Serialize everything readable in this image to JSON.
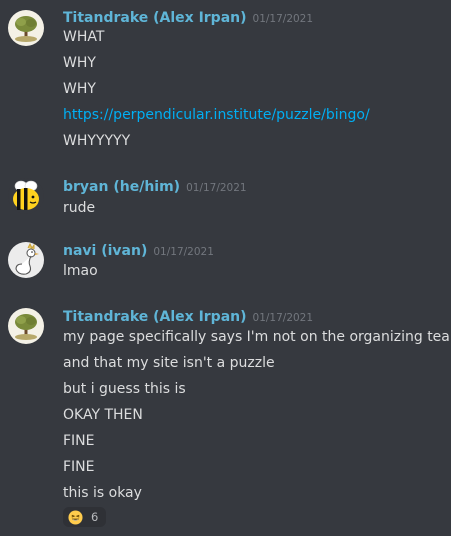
{
  "messages": [
    {
      "author": "Titandrake (Alex Irpan)",
      "timestamp": "01/17/2021",
      "lines": [
        "WHAT",
        "WHY",
        "WHY",
        "https://perpendicular.institute/puzzle/bingo/",
        "WHYYYYY"
      ]
    },
    {
      "author": "bryan (he/him)",
      "timestamp": "01/17/2021",
      "lines": [
        "rude"
      ]
    },
    {
      "author": "navi (ivan)",
      "timestamp": "01/17/2021",
      "lines": [
        "lmao"
      ]
    },
    {
      "author": "Titandrake (Alex Irpan)",
      "timestamp": "01/17/2021",
      "lines": [
        "my page specifically says I'm not on the organizing team",
        "and that my site isn't a puzzle",
        "but i guess this is",
        "OKAY THEN",
        "FINE",
        "FINE",
        "this is okay"
      ],
      "reaction": {
        "emoji": "grinning-squinting-face-icon",
        "count": "6"
      }
    }
  ],
  "colors": {
    "background": "#36393f",
    "username": "#5fb5d7",
    "link": "#00aff4",
    "timestamp": "#72767d",
    "text": "#dcddde"
  }
}
